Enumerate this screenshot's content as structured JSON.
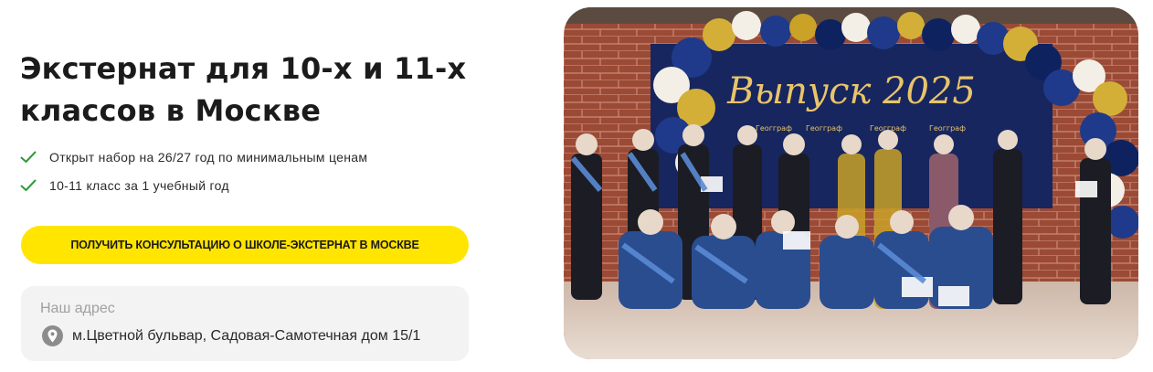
{
  "heading": {
    "line1": "Экстернат для 10-х и 11-х",
    "line2": "классов в Москве"
  },
  "features": [
    {
      "icon": "check-icon",
      "text": "Открыт набор на 26/27 год по минимальным ценам"
    },
    {
      "icon": "check-icon",
      "text": "10-11 класс за 1 учебный год"
    }
  ],
  "cta": {
    "label": "ПОЛУЧИТЬ КОНСУЛЬТАЦИЮ О ШКОЛЕ-ЭКСТЕРНАТ В МОСКВЕ"
  },
  "address": {
    "label": "Наш адрес",
    "icon": "location-pin-icon",
    "text": "м.Цветной бульвар, Садовая-Самотечная дом 15/1"
  },
  "photo": {
    "banner_text": "Выпуск 2025",
    "logo_text": "Геогграф"
  },
  "colors": {
    "accent": "#ffe500",
    "check": "#2e9a3a",
    "banner": "#17265e",
    "brick": "#9b4a35"
  }
}
